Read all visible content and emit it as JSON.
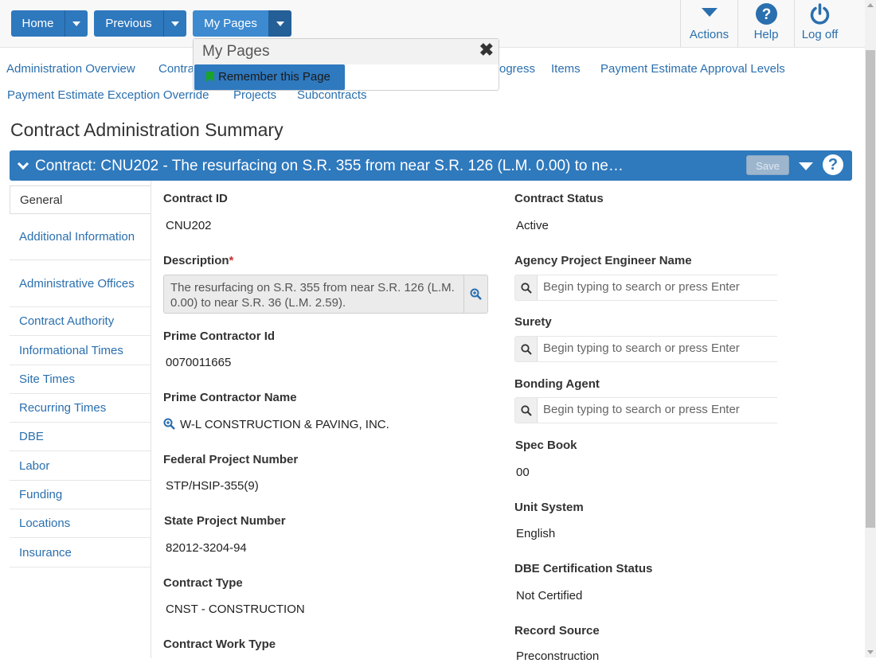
{
  "toolbar": {
    "home_label": "Home",
    "previous_label": "Previous",
    "mypages_label": "My Pages",
    "actions_label": "Actions",
    "help_label": "Help",
    "logoff_label": "Log off"
  },
  "popup": {
    "title": "My Pages",
    "close_glyph": "✖",
    "remember_label": "Remember this Page"
  },
  "nav_links": {
    "row1": [
      "Administration Overview",
      "Contra",
      "ogress",
      "Items",
      "Payment Estimate Approval Levels"
    ],
    "row2": [
      "Payment Estimate Exception Override",
      "Projects",
      "Subcontracts"
    ]
  },
  "page_title": "Contract Administration Summary",
  "contract_bar": {
    "title": "Contract: CNU202 - The resurfacing on S.R. 355 from near S.R. 126 (L.M. 0.00) to ne…",
    "save_label": "Save",
    "help_glyph": "?"
  },
  "sidenav": {
    "items": [
      "General",
      "Additional Information",
      "Administrative Offices",
      "Contract Authority",
      "Informational Times",
      "Site Times",
      "Recurring Times",
      "DBE",
      "Labor",
      "Funding",
      "Locations",
      "Insurance"
    ]
  },
  "fields_left": {
    "contract_id": {
      "label": "Contract ID",
      "value": "CNU202"
    },
    "description": {
      "label": "Description",
      "required": "*",
      "value": "The resurfacing on S.R. 355 from near S.R. 126 (L.M. 0.00) to near S.R. 36 (L.M. 2.59)."
    },
    "prime_contractor_id": {
      "label": "Prime Contractor Id",
      "value": "0070011665"
    },
    "prime_contractor_name": {
      "label": "Prime Contractor Name",
      "value": "W-L CONSTRUCTION & PAVING, INC."
    },
    "federal_project_number": {
      "label": "Federal Project Number",
      "value": "STP/HSIP-355(9)"
    },
    "state_project_number": {
      "label": "State Project Number",
      "value": "82012-3204-94"
    },
    "contract_type": {
      "label": "Contract Type",
      "value": "CNST - CONSTRUCTION"
    },
    "contract_work_type": {
      "label": "Contract Work Type"
    }
  },
  "fields_right": {
    "contract_status": {
      "label": "Contract Status",
      "value": "Active"
    },
    "agency_project_engineer": {
      "label": "Agency Project Engineer Name",
      "placeholder": "Begin typing to search or press Enter"
    },
    "surety": {
      "label": "Surety",
      "placeholder": "Begin typing to search or press Enter"
    },
    "bonding_agent": {
      "label": "Bonding Agent",
      "placeholder": "Begin typing to search or press Enter"
    },
    "spec_book": {
      "label": "Spec Book",
      "value": "00"
    },
    "unit_system": {
      "label": "Unit System",
      "value": "English"
    },
    "dbe_certification_status": {
      "label": "DBE Certification Status",
      "value": "Not Certified"
    },
    "record_source": {
      "label": "Record Source",
      "value": "Preconstruction"
    }
  },
  "colors": {
    "primary": "#2e78bd",
    "link": "#2a6fae",
    "required": "#c9302c",
    "bookmark": "#19a32b"
  }
}
